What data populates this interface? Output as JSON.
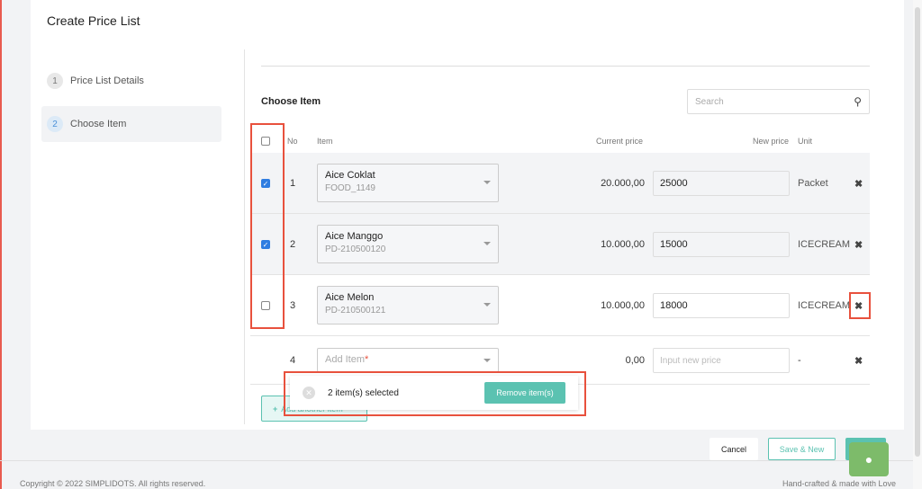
{
  "title": "Create Price List",
  "steps": [
    {
      "num": "1",
      "label": "Price List Details"
    },
    {
      "num": "2",
      "label": "Choose Item"
    }
  ],
  "section_title": "Choose Item",
  "search_placeholder": "Search",
  "columns": {
    "no": "No",
    "item": "Item",
    "current": "Current price",
    "new": "New price",
    "unit": "Unit"
  },
  "rows": [
    {
      "no": "1",
      "name": "Aice Coklat",
      "code": "FOOD_1149",
      "current": "20.000,00",
      "new": "25000",
      "unit": "Packet",
      "checked": true
    },
    {
      "no": "2",
      "name": "Aice Manggo",
      "code": "PD-210500120",
      "current": "10.000,00",
      "new": "15000",
      "unit": "ICECREAM",
      "checked": true
    },
    {
      "no": "3",
      "name": "Aice Melon",
      "code": "PD-210500121",
      "current": "10.000,00",
      "new": "18000",
      "unit": "ICECREAM",
      "checked": false
    }
  ],
  "new_row": {
    "no": "4",
    "placeholder": "Add Item",
    "required": "*",
    "current": "0,00",
    "price_placeholder": "Input new price",
    "unit": "-"
  },
  "add_another": "Add another item",
  "selection": {
    "text": "2 item(s) selected",
    "remove": "Remove item(s)"
  },
  "footer": {
    "cancel": "Cancel",
    "save_new": "Save & New",
    "copyright": "Copyright © 2022 SIMPLIDOTS. All rights reserved.",
    "tagline": "Hand-crafted & made with Love"
  },
  "colors": {
    "accent": "#5bc2b1",
    "annotation": "#e8513d",
    "chat": "#7dbb6a"
  }
}
